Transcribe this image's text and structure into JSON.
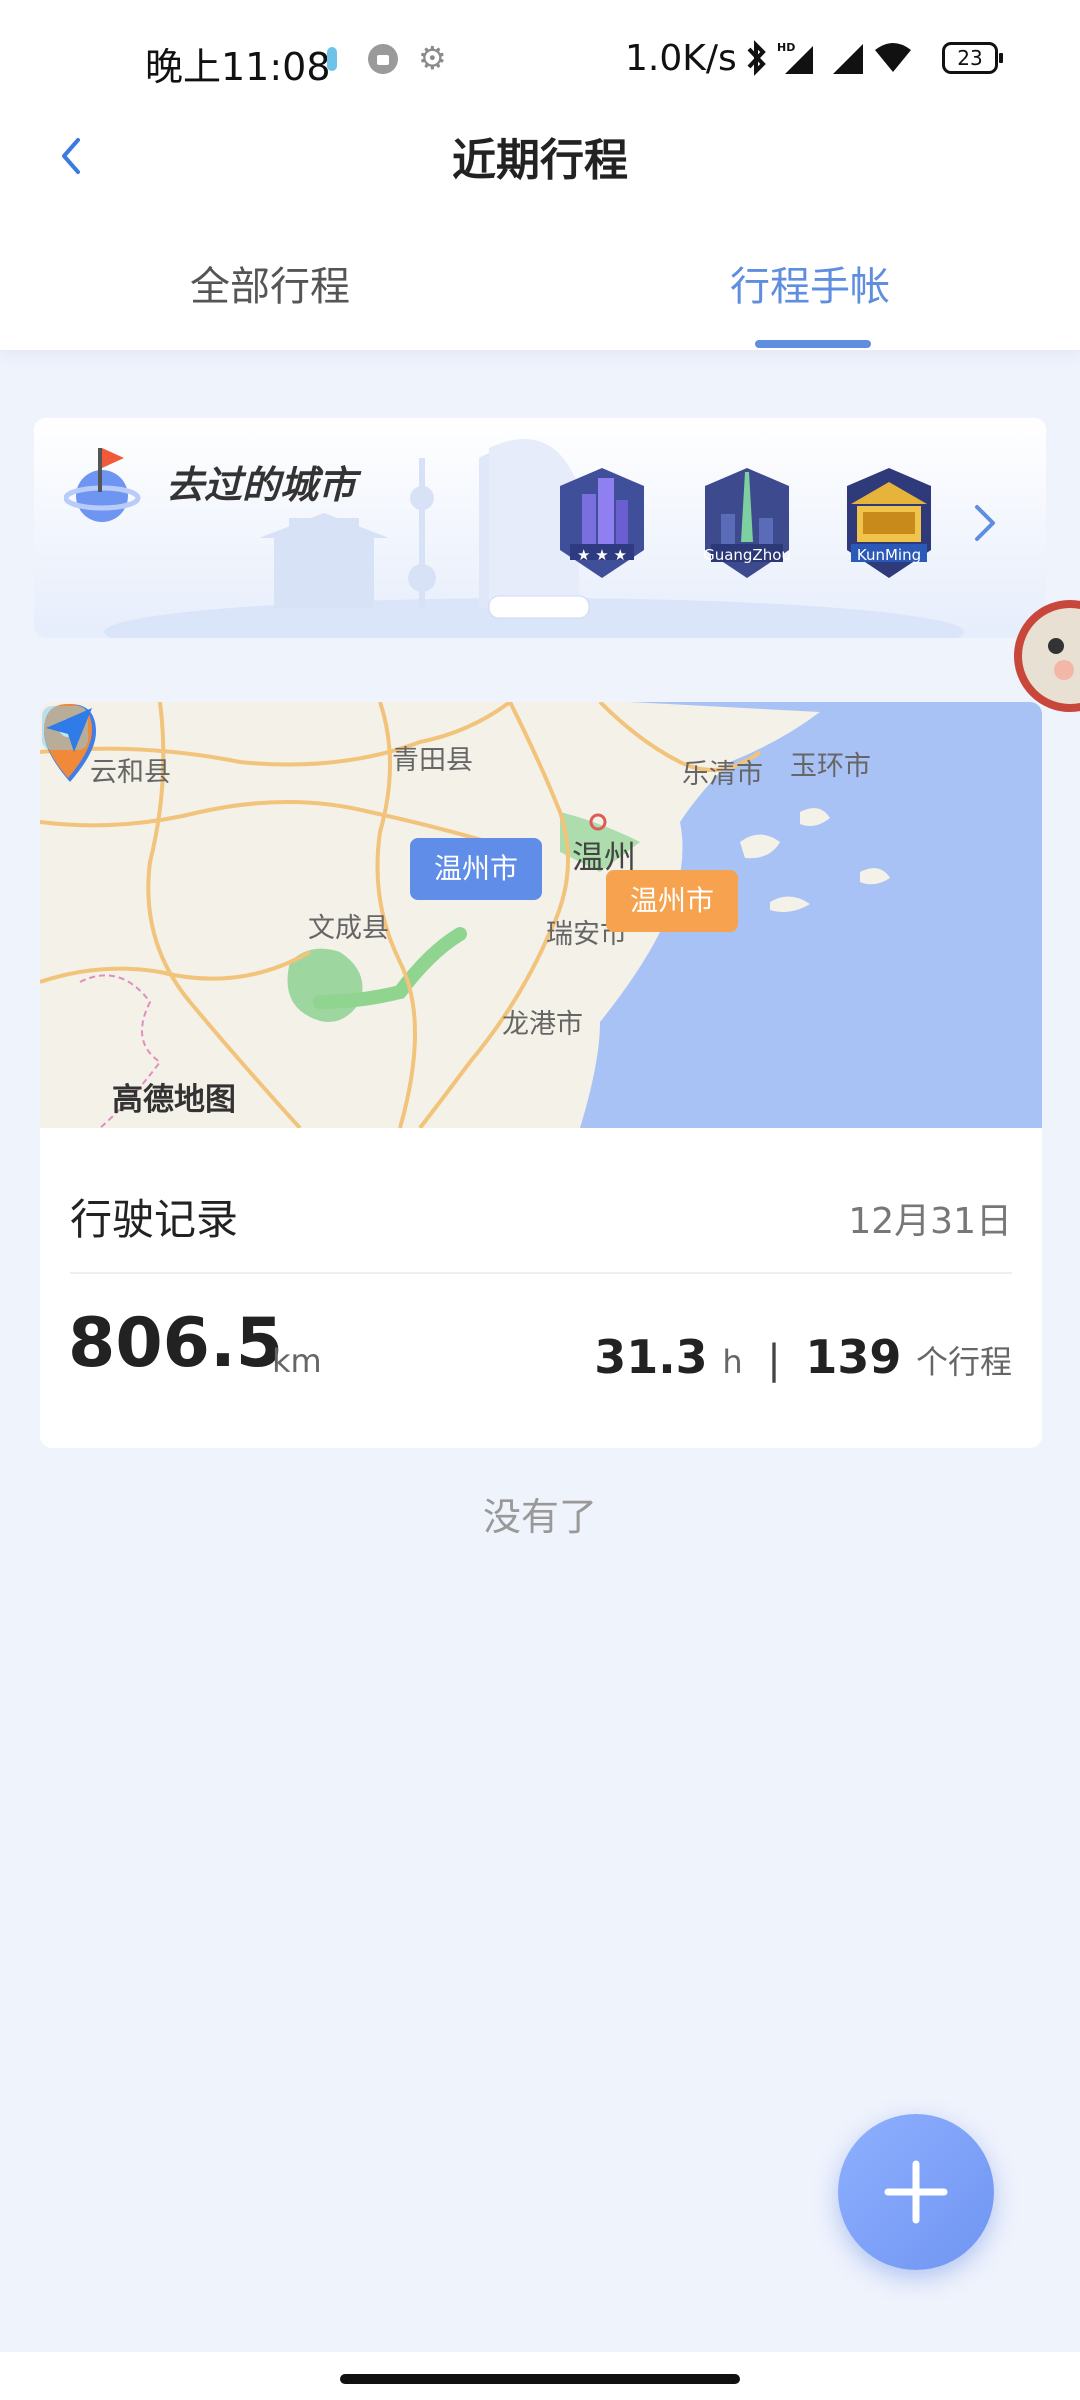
{
  "status_bar": {
    "time": "晚上11:08",
    "network_speed": "1.0K/s",
    "battery": "23"
  },
  "header": {
    "title": "近期行程"
  },
  "tabs": [
    {
      "label": "全部行程",
      "active": false
    },
    {
      "label": "行程手帐",
      "active": true
    }
  ],
  "cities_card": {
    "title": "去过的城市",
    "badges": [
      {
        "label": "★ ★ ★"
      },
      {
        "label": "GuangZhou"
      },
      {
        "label": "KunMing"
      }
    ]
  },
  "map": {
    "labels": [
      "云和县",
      "青田县",
      "乐清市",
      "玉环市",
      "温州",
      "文成县",
      "瑞安市",
      "龙港市"
    ],
    "start_tag": "温州市",
    "end_tag": "温州市",
    "provider": "高德地图"
  },
  "record": {
    "title": "行驶记录",
    "date": "12月31日",
    "distance": "806.5",
    "distance_unit": "km",
    "hours": "31.3",
    "hours_unit": "h",
    "separator": "|",
    "trips": "139",
    "trips_unit": "个行程"
  },
  "footer_text": "没有了",
  "colors": {
    "accent": "#5f8de0",
    "background": "#eff3fc",
    "tag_start": "#5f8de8",
    "tag_end": "#f7a24e"
  }
}
